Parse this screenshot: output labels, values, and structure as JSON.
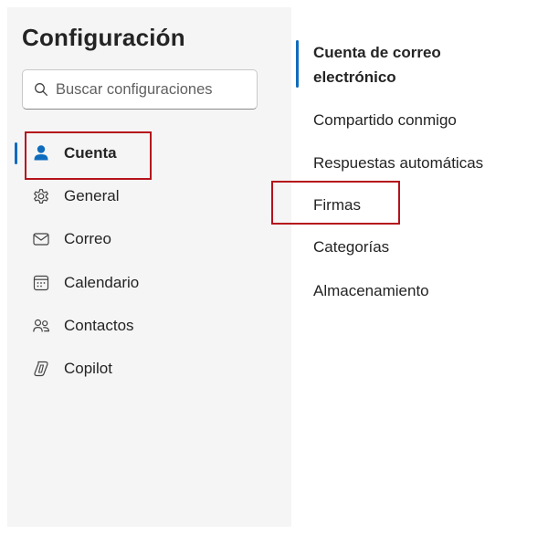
{
  "settings": {
    "title": "Configuración",
    "search": {
      "placeholder": "Buscar configuraciones",
      "value": ""
    },
    "nav": [
      {
        "label": "Cuenta",
        "icon": "person-icon",
        "selected": true
      },
      {
        "label": "General",
        "icon": "gear-icon"
      },
      {
        "label": "Correo",
        "icon": "mail-icon"
      },
      {
        "label": "Calendario",
        "icon": "calendar-icon"
      },
      {
        "label": "Contactos",
        "icon": "people-icon"
      },
      {
        "label": "Copilot",
        "icon": "copilot-icon"
      }
    ],
    "account_submenu": [
      {
        "label": "Cuenta de correo electrónico",
        "selected": true
      },
      {
        "label": "Compartido conmigo"
      },
      {
        "label": "Respuestas automáticas"
      },
      {
        "label": "Firmas"
      },
      {
        "label": "Categorías"
      },
      {
        "label": "Almacenamiento"
      }
    ]
  },
  "colors": {
    "accent": "#0f6cbd",
    "highlight": "#b5121b",
    "left_pane_bg": "#f5f5f5"
  }
}
